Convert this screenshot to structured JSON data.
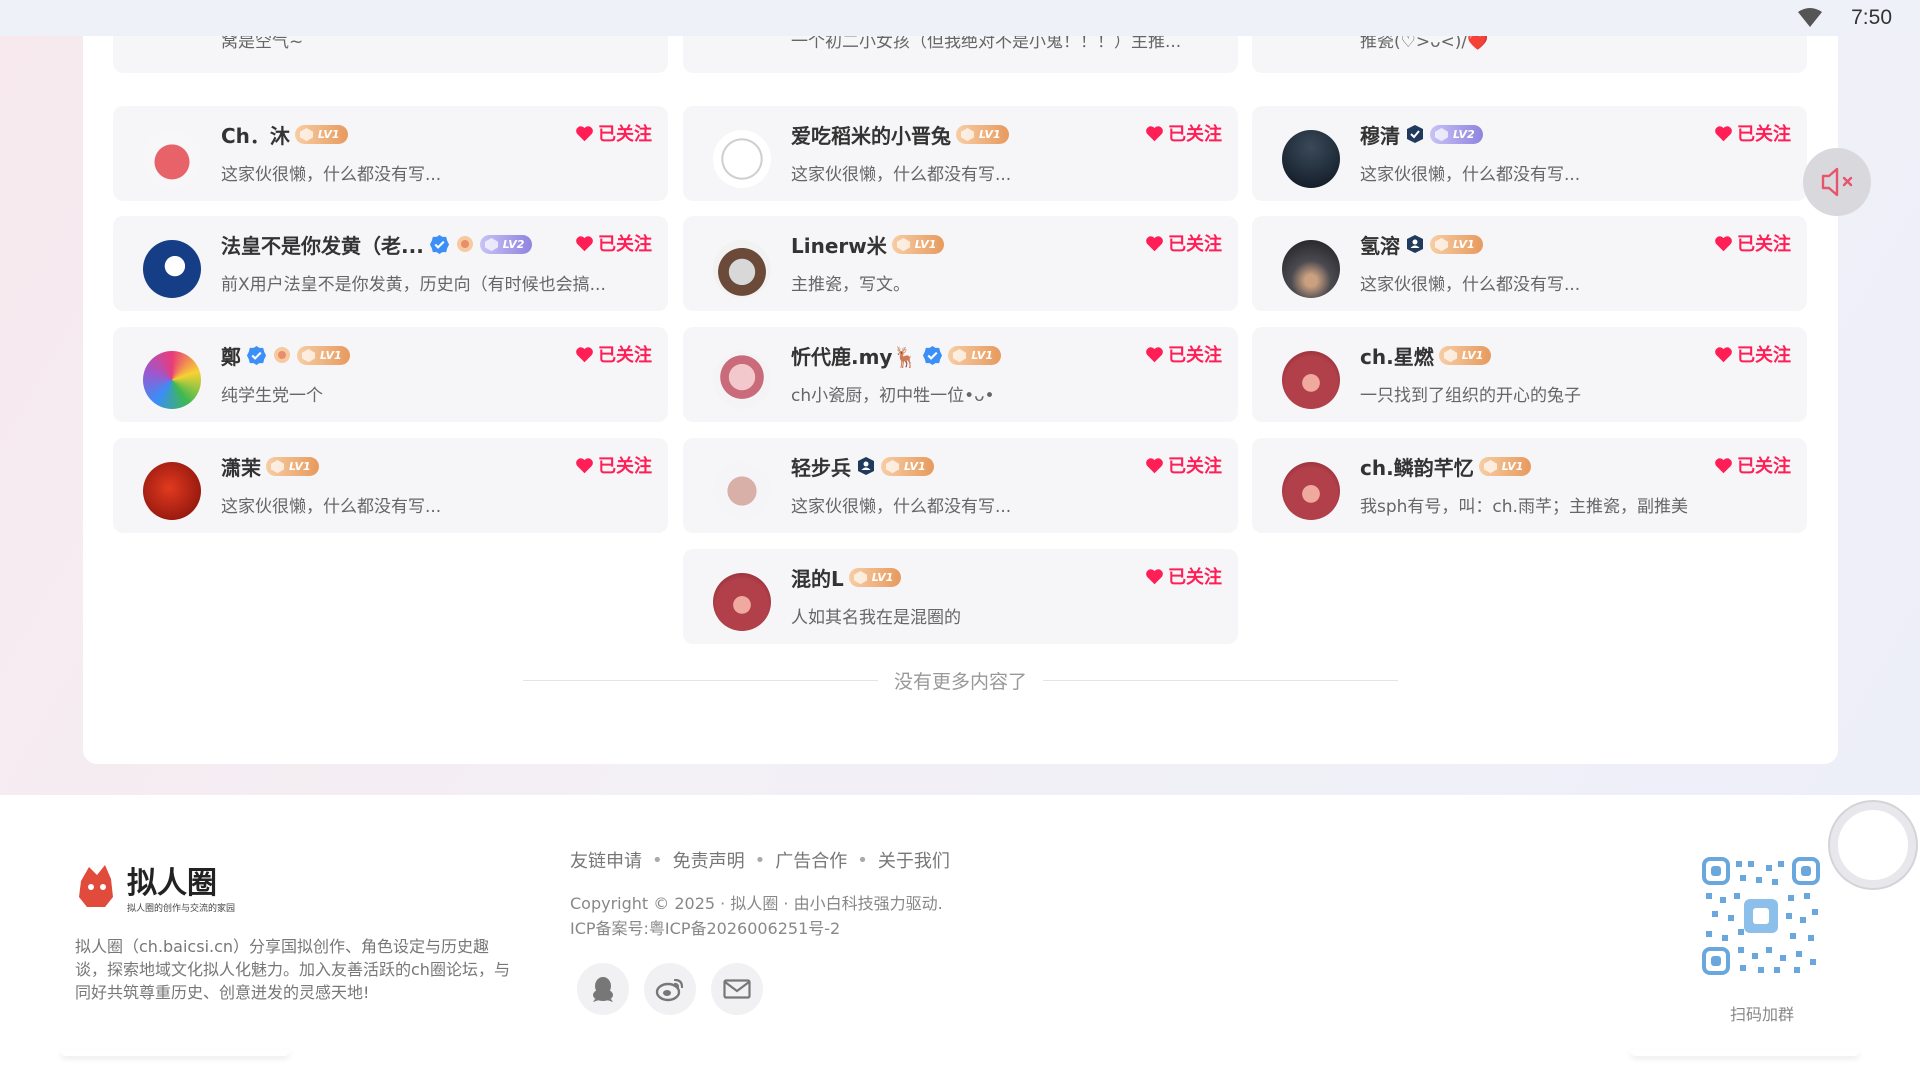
{
  "status_bar": {
    "time": "7:50",
    "wifi_icon": "wifi-icon"
  },
  "colors": {
    "follow": "#ff1e55",
    "lv1": "#e79a5d",
    "lv2": "#8e84df",
    "verified": "#3b8ff6"
  },
  "users": [
    {
      "name": "",
      "bio": "窝是空气~",
      "followed": "",
      "level": ""
    },
    {
      "name": "",
      "bio": "一个初二小女孩（但我绝对不是小鬼！！！）主推...",
      "followed": "",
      "level": ""
    },
    {
      "name": "",
      "bio": "推瓷(♡>ᴗ<)/❤️",
      "followed": "",
      "level": ""
    },
    {
      "name": "Ch．沐",
      "bio": "这家伙很懒，什么都没有写...",
      "followed": "已关注",
      "level": "LV1"
    },
    {
      "name": "爱吃稻米的小晋兔",
      "bio": "这家伙很懒，什么都没有写...",
      "followed": "已关注",
      "level": "LV1"
    },
    {
      "name": "穆清",
      "bio": "这家伙很懒，什么都没有写...",
      "followed": "已关注",
      "level": "LV2"
    },
    {
      "name": "法皇不是你发黄（老...",
      "bio": "前X用户法皇不是你发黄，历史向（有时候也会搞...",
      "followed": "已关注",
      "level": "LV2"
    },
    {
      "name": "Linerw米",
      "bio": "主推瓷，写文。",
      "followed": "已关注",
      "level": "LV1"
    },
    {
      "name": "氢溶",
      "bio": "这家伙很懒，什么都没有写...",
      "followed": "已关注",
      "level": "LV1"
    },
    {
      "name": "鄭",
      "bio": "纯学生党一个",
      "followed": "已关注",
      "level": "LV1"
    },
    {
      "name": "忻代鹿.my🦌",
      "bio": "ch小瓷厨，初中牲一位•ᴗ•",
      "followed": "已关注",
      "level": "LV1"
    },
    {
      "name": "ch.星燃",
      "bio": "一只找到了组织的开心的兔子",
      "followed": "已关注",
      "level": "LV1"
    },
    {
      "name": "潇茉",
      "bio": "这家伙很懒，什么都没有写...",
      "followed": "已关注",
      "level": "LV1"
    },
    {
      "name": "轻步兵",
      "bio": "这家伙很懒，什么都没有写...",
      "followed": "已关注",
      "level": "LV1"
    },
    {
      "name": "ch.鳞韵芊忆",
      "bio": "我sph有号，叫：ch.雨芊；主推瓷，副推美",
      "followed": "已关注",
      "level": "LV1"
    },
    {
      "name": "混的L",
      "bio": "人如其名我在是混圈的",
      "followed": "已关注",
      "level": "LV1"
    }
  ],
  "list_end": "没有更多内容了",
  "footer": {
    "brand_name": "拟人圈",
    "brand_tagline": "拟人圈的创作与交流的家园",
    "description": "拟人圈（ch.baicsi.cn）分享国拟创作、角色设定与历史趣谈，探索地域文化拟人化魅力。加入友善活跃的ch圈论坛，与同好共筑尊重历史、创意迸发的灵感天地!",
    "links": [
      "友链申请",
      "免责声明",
      "广告合作",
      "关于我们"
    ],
    "copyright": "Copyright © 2025 · 拟人圈 · 由小白科技强力驱动.",
    "icp": "ICP备案号:粤ICP备2026006251号-2",
    "social_icons": [
      "qq-icon",
      "weibo-icon",
      "mail-icon"
    ],
    "qr_label": "扫码加群"
  }
}
